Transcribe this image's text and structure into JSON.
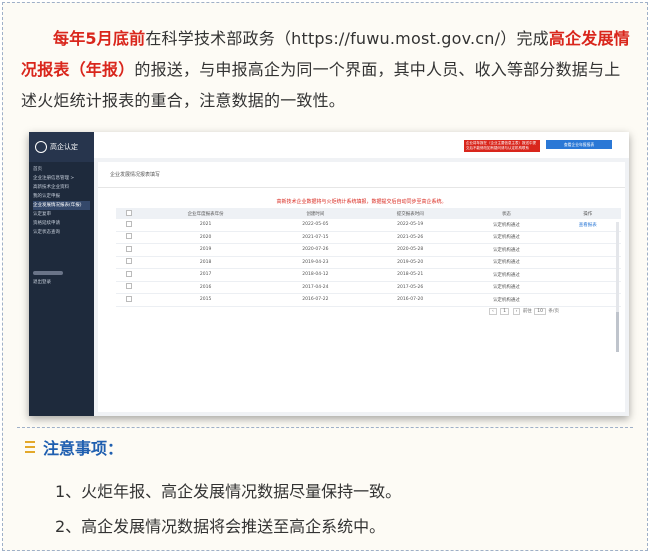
{
  "intro": {
    "deadline": "每年5月底前",
    "part1": "在科学技术部政务（https://fuwu.most.gov.cn/）完成",
    "report": "高企发展情况报表（年报）",
    "part2": "的报送，与申报高企为同一个界面，其中人员、收入等部分数据与上述火炬统计报表的重合，注意数据的一致性。"
  },
  "screenshot": {
    "app_title": "高企认定",
    "nav": [
      "首页",
      "企业注册信息管理 >",
      "高新技术企业资料",
      "我的认定申报",
      "企业发展情况报表(年报)",
      "认定复审",
      "资格延续申请",
      "认定状态查询"
    ],
    "nav_active_index": 4,
    "user_label": "退出登录",
    "warn_button": "企业将年报在（企业主要信息主表）报送中提交后不能修改如有疑问请与认定机构联系",
    "blue_button": "查看企业年报报表",
    "panel_title": "企业发展情况报表填写",
    "notice": "高新技术企业数据将与火炬统计系统填报，数据提交后自动同步至高企系统。",
    "table_headers": [
      "",
      "企业年度报表年份",
      "创建时间",
      "提交报表时间",
      "状态",
      "操作"
    ],
    "rows": [
      {
        "year": "2021",
        "created": "2022-05-05",
        "submitted": "2022-05-19",
        "status": "认定机构通过",
        "action": "查看报表"
      },
      {
        "year": "2020",
        "created": "2021-07-15",
        "submitted": "2021-05-26",
        "status": "认定机构通过",
        "action": ""
      },
      {
        "year": "2019",
        "created": "2020-07-26",
        "submitted": "2020-05-28",
        "status": "认定机构通过",
        "action": ""
      },
      {
        "year": "2018",
        "created": "2019-04-23",
        "submitted": "2019-05-20",
        "status": "认定机构通过",
        "action": ""
      },
      {
        "year": "2017",
        "created": "2018-04-12",
        "submitted": "2018-05-21",
        "status": "认定机构通过",
        "action": ""
      },
      {
        "year": "2016",
        "created": "2017-04-24",
        "submitted": "2017-05-26",
        "status": "认定机构通过",
        "action": ""
      },
      {
        "year": "2015",
        "created": "2016-07-22",
        "submitted": "2016-07-20",
        "status": "认定机构通过",
        "action": ""
      }
    ],
    "pager": {
      "prev": "‹",
      "page": "1",
      "next": "›",
      "goto": "前往",
      "page_size": "10",
      "total": "条/页"
    }
  },
  "notes": {
    "heading": "注意事项：",
    "items": [
      "1、火炬年报、高企发展情况数据尽量保持一致。",
      "2、高企发展情况数据将会推送至高企系统中。"
    ]
  }
}
